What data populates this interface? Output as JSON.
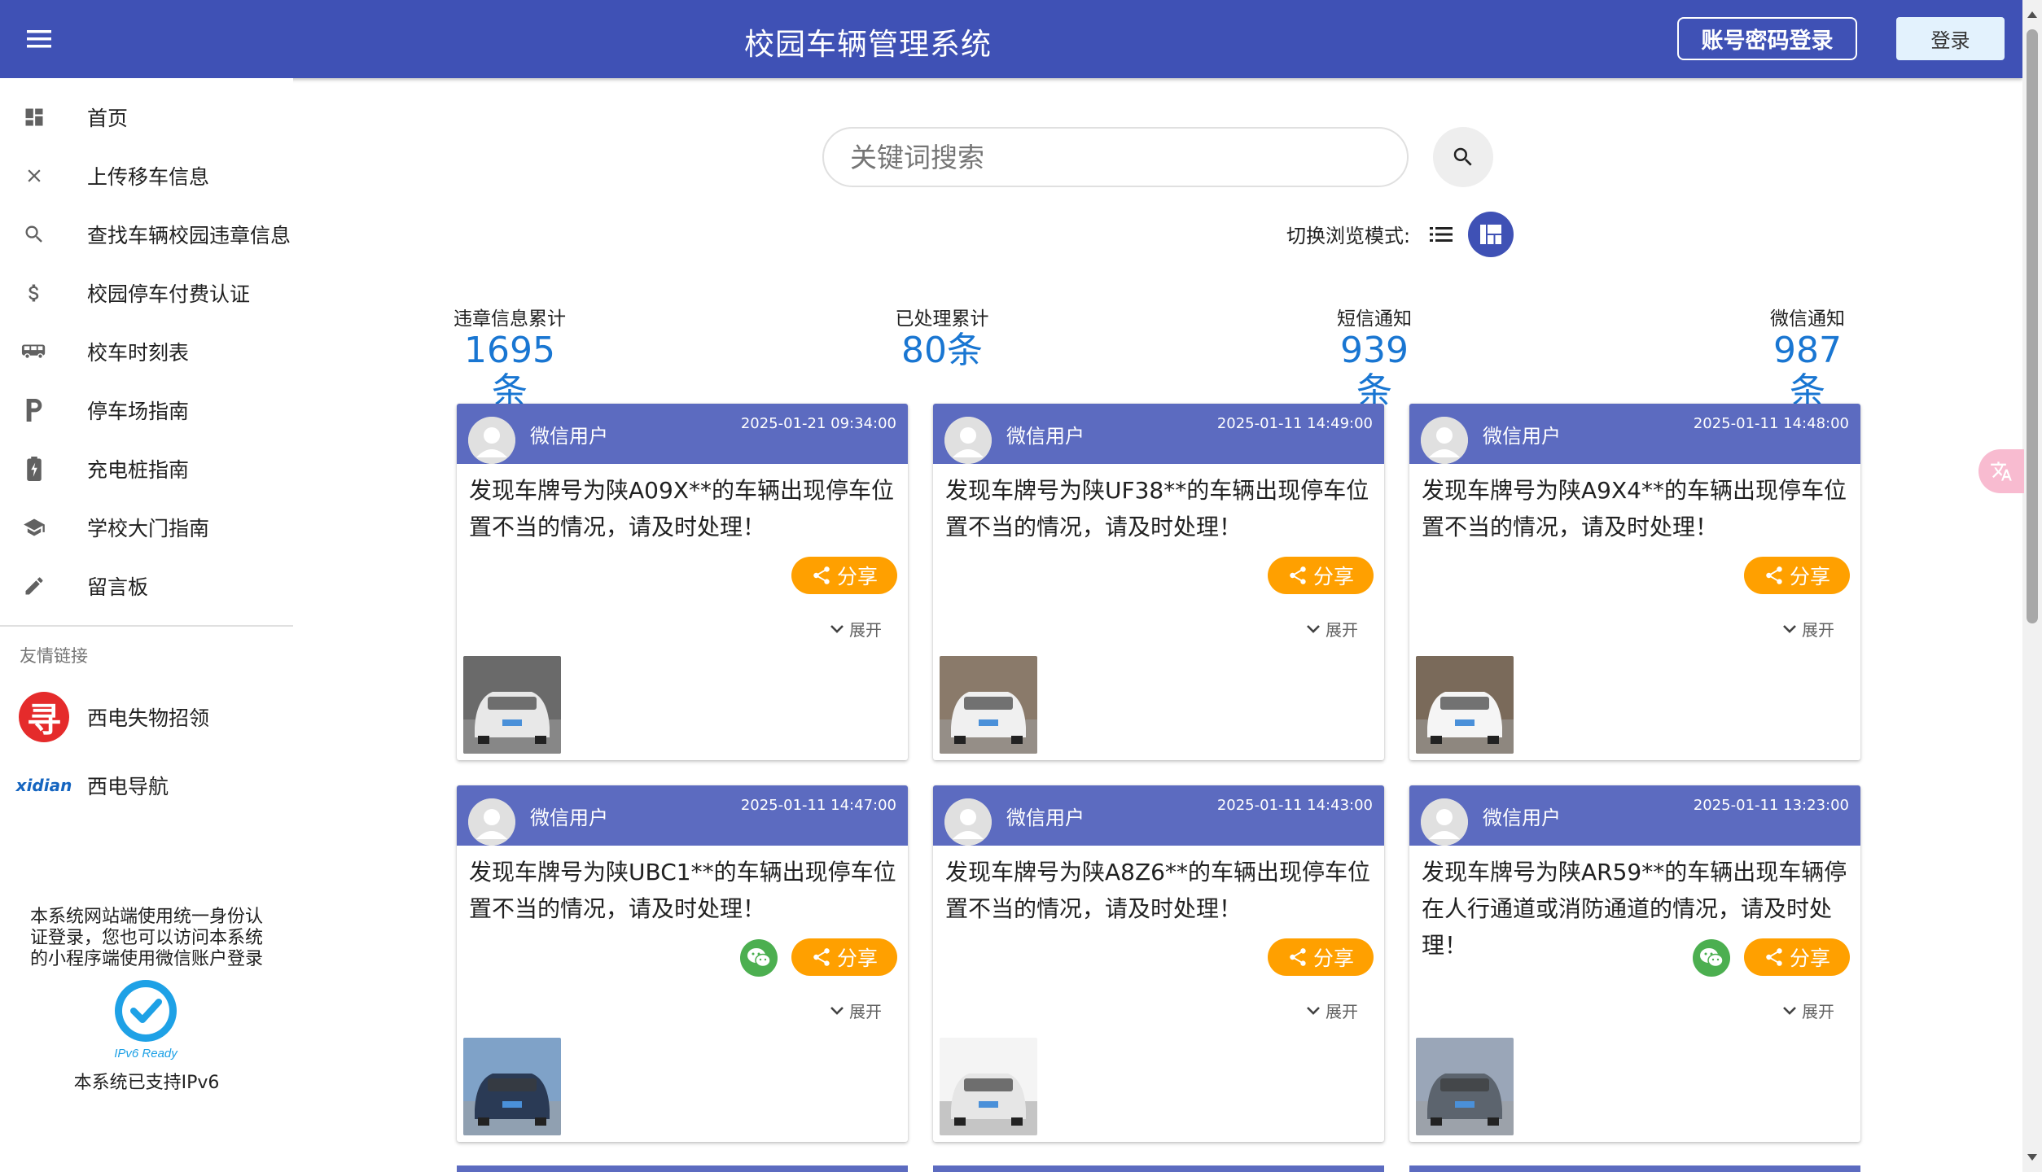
{
  "appbar": {
    "title": "校园车辆管理系统",
    "account_login_label": "账号密码登录",
    "login_label": "登录"
  },
  "sidebar": {
    "items": [
      {
        "label": "首页",
        "icon": "dashboard-icon"
      },
      {
        "label": "上传移车信息",
        "icon": "close-icon"
      },
      {
        "label": "查找车辆校园违章信息",
        "icon": "search-icon"
      },
      {
        "label": "校园停车付费认证",
        "icon": "dollar-icon"
      },
      {
        "label": "校车时刻表",
        "icon": "bus-icon"
      },
      {
        "label": "停车场指南",
        "icon": "parking-icon"
      },
      {
        "label": "充电桩指南",
        "icon": "battery-charging-icon"
      },
      {
        "label": "学校大门指南",
        "icon": "school-icon"
      },
      {
        "label": "留言板",
        "icon": "pencil-icon"
      }
    ],
    "friend_links_title": "友情链接",
    "friend_links": [
      {
        "label": "西电失物招领",
        "logo_text": "寻"
      },
      {
        "label": "西电导航",
        "logo_text": "xidian"
      }
    ],
    "notice": "本系统网站端使用统一身份认证登录，您也可以访问本系统的小程序端使用微信账户登录",
    "ipv6_badge_text": "IPv6 Ready",
    "ipv6_text": "本系统已支持IPv6"
  },
  "search": {
    "placeholder": "关键词搜索"
  },
  "view_mode": {
    "label": "切换浏览模式:"
  },
  "stats": [
    {
      "label": "违章信息累计",
      "value": "1695条"
    },
    {
      "label": "已处理累计",
      "value": "80条"
    },
    {
      "label": "短信通知",
      "value": "939条"
    },
    {
      "label": "微信通知",
      "value": "987条"
    }
  ],
  "cards": [
    {
      "user": "微信用户",
      "time": "2025-01-21 09:34:00",
      "text": "发现车牌号为陕A09X**的车辆出现停车位置不当的情况，请及时处理！",
      "wechat": false,
      "share": "分享",
      "expand": "展开",
      "photo_colors": [
        "#6a6a6a",
        "#e8e8e8"
      ]
    },
    {
      "user": "微信用户",
      "time": "2025-01-11 14:49:00",
      "text": "发现车牌号为陕UF38**的车辆出现停车位置不当的情况，请及时处理！",
      "wechat": false,
      "share": "分享",
      "expand": "展开",
      "photo_colors": [
        "#8a7a6a",
        "#f0f0f0"
      ]
    },
    {
      "user": "微信用户",
      "time": "2025-01-11 14:48:00",
      "text": "发现车牌号为陕A9X4**的车辆出现停车位置不当的情况，请及时处理！",
      "wechat": false,
      "share": "分享",
      "expand": "展开",
      "photo_colors": [
        "#7a6a5a",
        "#f5f5f5"
      ]
    },
    {
      "user": "微信用户",
      "time": "2025-01-11 14:47:00",
      "text": "发现车牌号为陕UBC1**的车辆出现停车位置不当的情况，请及时处理！",
      "wechat": true,
      "share": "分享",
      "expand": "展开",
      "photo_colors": [
        "#7fa2c8",
        "#2a3a55"
      ]
    },
    {
      "user": "微信用户",
      "time": "2025-01-11 14:43:00",
      "text": "发现车牌号为陕A8Z6**的车辆出现停车位置不当的情况，请及时处理！",
      "wechat": false,
      "share": "分享",
      "expand": "展开",
      "photo_colors": [
        "#f4f4f4",
        "#e6e6e6"
      ]
    },
    {
      "user": "微信用户",
      "time": "2025-01-11 13:23:00",
      "text": "发现车牌号为陕AR59**的车辆出现车辆停在人行通道或消防通道的情况，请及时处理！",
      "wechat": true,
      "share": "分享",
      "expand": "展开",
      "photo_colors": [
        "#9aa6b8",
        "#5c646e"
      ]
    }
  ]
}
